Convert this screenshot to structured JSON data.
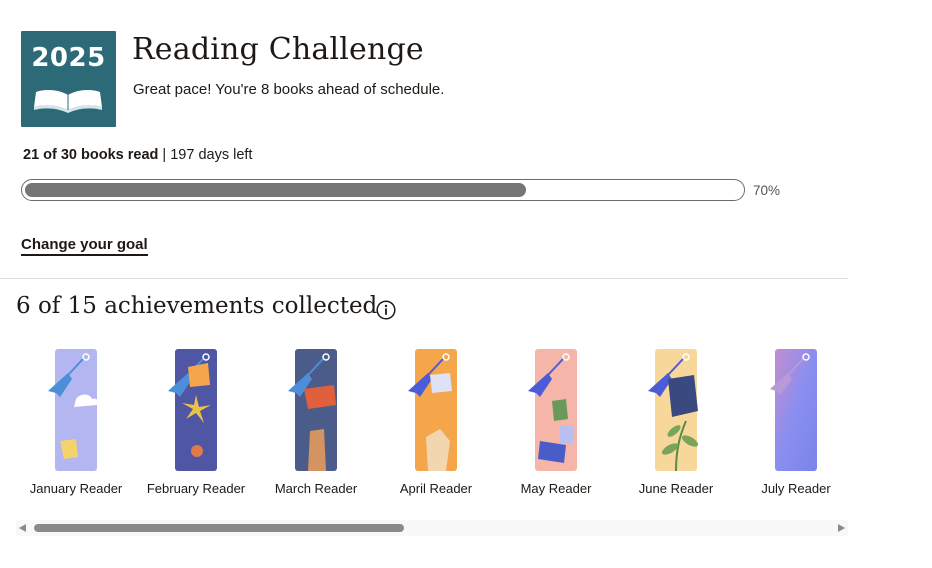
{
  "logo": {
    "year": "2025",
    "icon": "open-book-icon",
    "bg_color": "#2d6a78"
  },
  "header": {
    "title": "Reading Challenge",
    "subtitle": "Great pace! You're 8 books ahead of schedule."
  },
  "progress": {
    "books_read_text": "21 of 30 books read",
    "separator": " | ",
    "days_left_text": "197 days left",
    "percent": 70,
    "percent_label": "70%"
  },
  "links": {
    "change_goal": "Change your goal"
  },
  "achievements": {
    "heading": "6 of 15 achievements collected",
    "info_icon": "info-icon",
    "badges": [
      {
        "label": "January Reader",
        "color": "#b3b6f0"
      },
      {
        "label": "February Reader",
        "color": "#4f56a3"
      },
      {
        "label": "March Reader",
        "color": "#4c5c8a"
      },
      {
        "label": "April Reader",
        "color": "#f5a64b"
      },
      {
        "label": "May Reader",
        "color": "#f5b5a8"
      },
      {
        "label": "June Reader",
        "color": "#f8d89a"
      },
      {
        "label": "July Reader",
        "color": "#8a8ef0"
      }
    ]
  },
  "scrollbar": {
    "left_arrow": "scroll-left-arrow-icon",
    "right_arrow": "scroll-right-arrow-icon"
  }
}
